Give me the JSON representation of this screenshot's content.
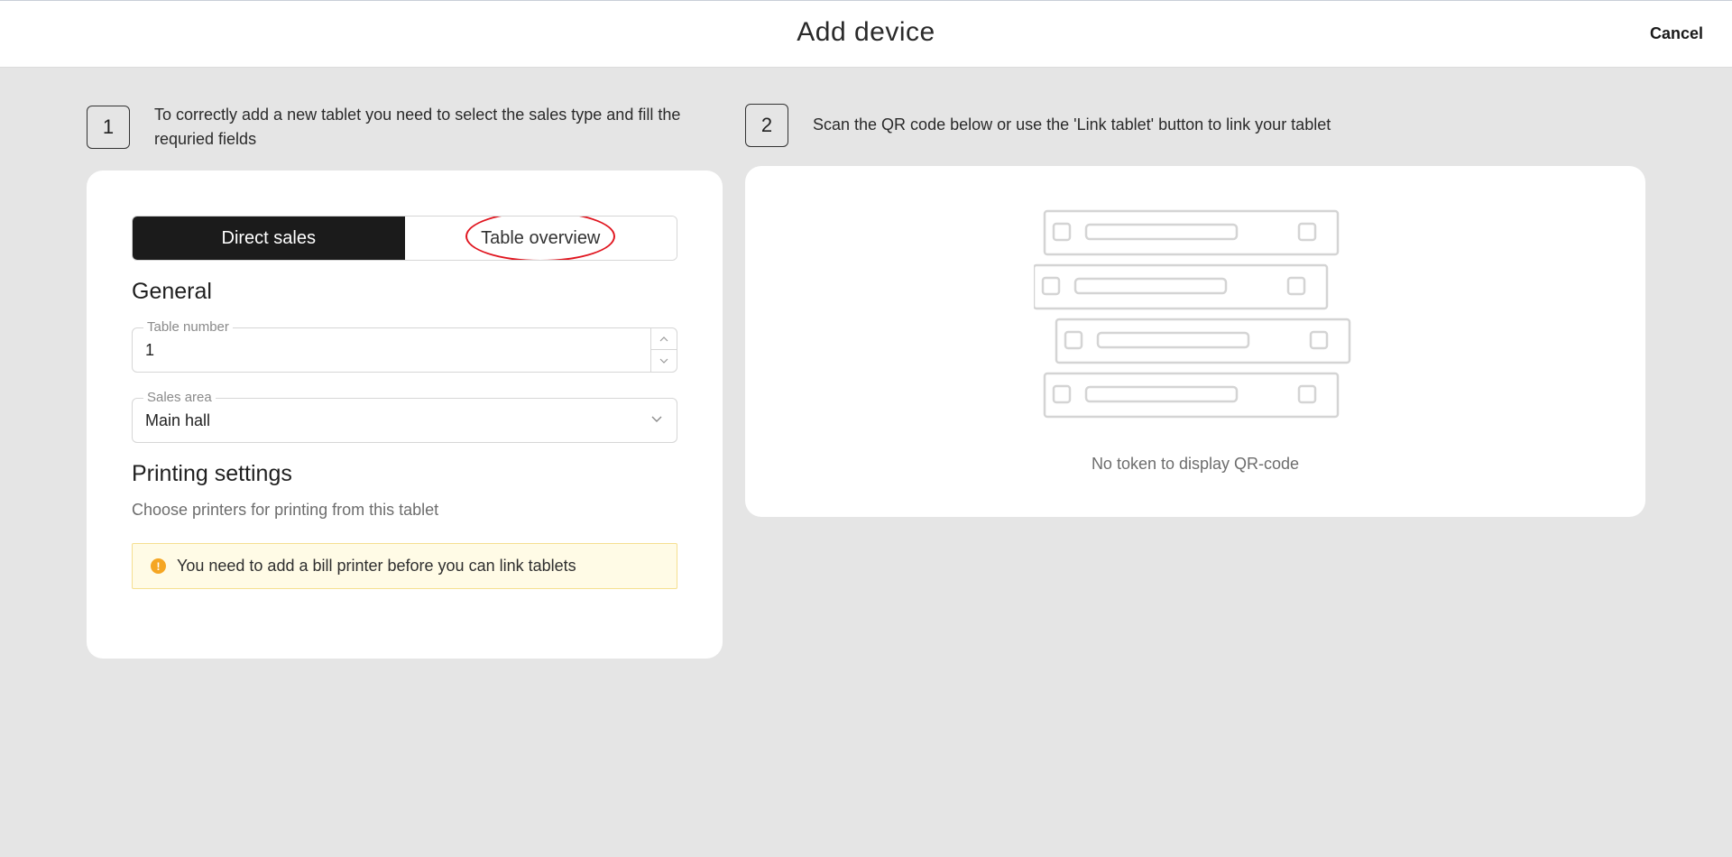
{
  "header": {
    "title": "Add device",
    "cancel_label": "Cancel"
  },
  "steps": [
    {
      "number": "1",
      "text": "To correctly add a new tablet you need to select the sales type and fill the requried fields"
    },
    {
      "number": "2",
      "text": "Scan the QR code below or use the 'Link tablet' button to link your tablet"
    }
  ],
  "form": {
    "sales_type": {
      "options": [
        "Direct sales",
        "Table overview"
      ],
      "selected": "Direct sales"
    },
    "general_title": "General",
    "table_number": {
      "label": "Table number",
      "value": "1"
    },
    "sales_area": {
      "label": "Sales area",
      "value": "Main hall"
    },
    "printing_title": "Printing settings",
    "printing_hint": "Choose printers for printing from this tablet",
    "warning": "You need to add a bill printer before you can link tablets"
  },
  "qr": {
    "empty_text": "No token to display QR-code"
  },
  "colors": {
    "background": "#e5e5e5",
    "active_segment": "#1b1b1b",
    "warning_bg": "#fffbe6",
    "warning_icon": "#f5a623",
    "annotation": "#e0141e"
  }
}
